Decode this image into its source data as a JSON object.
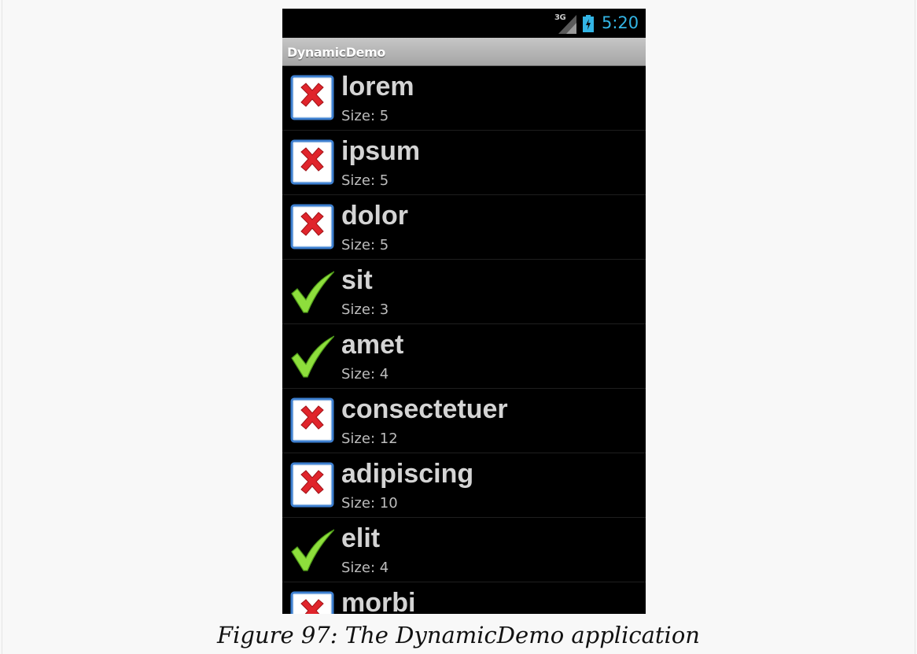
{
  "status_bar": {
    "network": "3G",
    "clock": "5:20"
  },
  "app": {
    "title": "DynamicDemo"
  },
  "list": {
    "items": [
      {
        "word": "lorem",
        "size": "Size: 5",
        "icon": "delete-x-icon"
      },
      {
        "word": "ipsum",
        "size": "Size: 5",
        "icon": "delete-x-icon"
      },
      {
        "word": "dolor",
        "size": "Size: 5",
        "icon": "delete-x-icon"
      },
      {
        "word": "sit",
        "size": "Size: 3",
        "icon": "check-icon"
      },
      {
        "word": "amet",
        "size": "Size: 4",
        "icon": "check-icon"
      },
      {
        "word": "consectetuer",
        "size": "Size: 12",
        "icon": "delete-x-icon"
      },
      {
        "word": "adipiscing",
        "size": "Size: 10",
        "icon": "delete-x-icon"
      },
      {
        "word": "elit",
        "size": "Size: 4",
        "icon": "check-icon"
      },
      {
        "word": "morbi",
        "size": "",
        "icon": "delete-x-icon"
      }
    ]
  },
  "caption": "Figure 97: The DynamicDemo application",
  "colors": {
    "clock": "#33b5e5",
    "check": "#8ede3c",
    "x_mark": "#e0242b"
  }
}
